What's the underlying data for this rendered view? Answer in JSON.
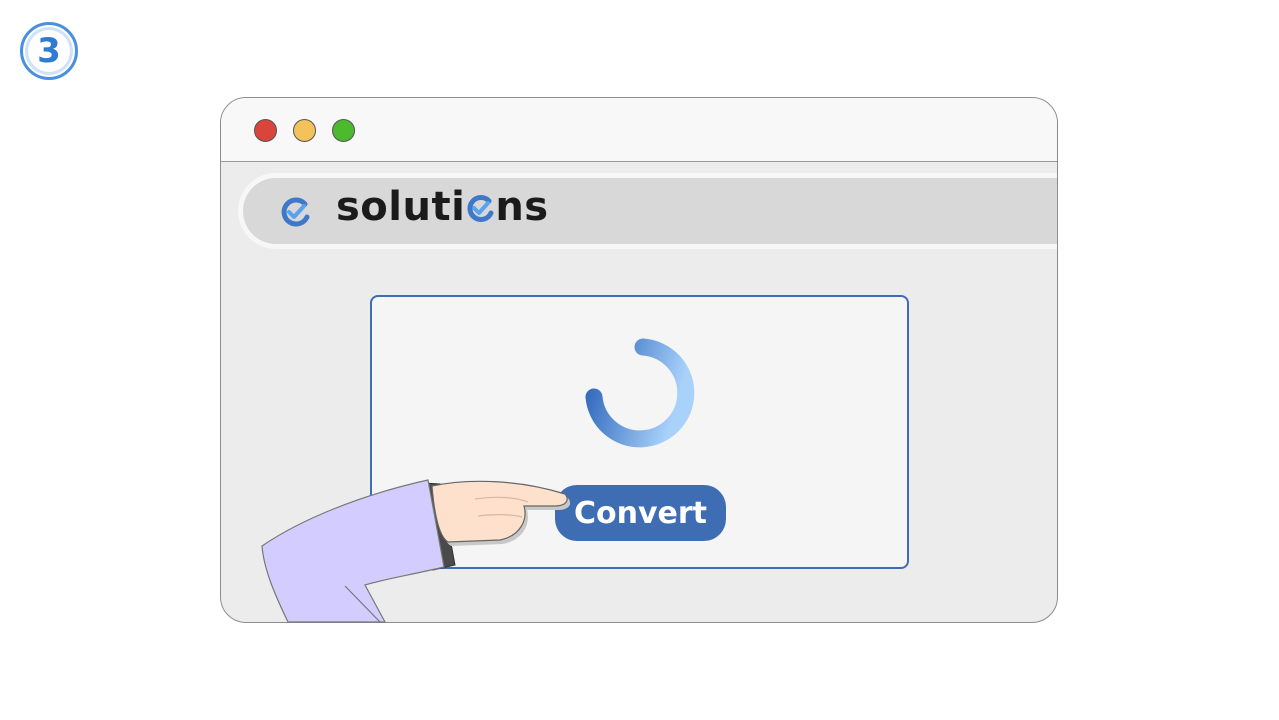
{
  "step": {
    "number": "3"
  },
  "browser": {
    "window_controls": [
      "close",
      "minimize",
      "maximize"
    ],
    "site_name_parts": {
      "before": "soluti",
      "after": "ns"
    },
    "logo_icon": "check-circle-icon"
  },
  "panel": {
    "status": "loading",
    "spinner_icon": "loading-spinner-icon",
    "convert_label": "Convert"
  },
  "colors": {
    "accent": "#3f6db4",
    "badge": "#2f7ad6",
    "close": "#d9453b",
    "minimize": "#f4c25a",
    "maximize": "#4dba2e",
    "sleeve": "#d3ccff",
    "skin": "#fde1cd"
  }
}
